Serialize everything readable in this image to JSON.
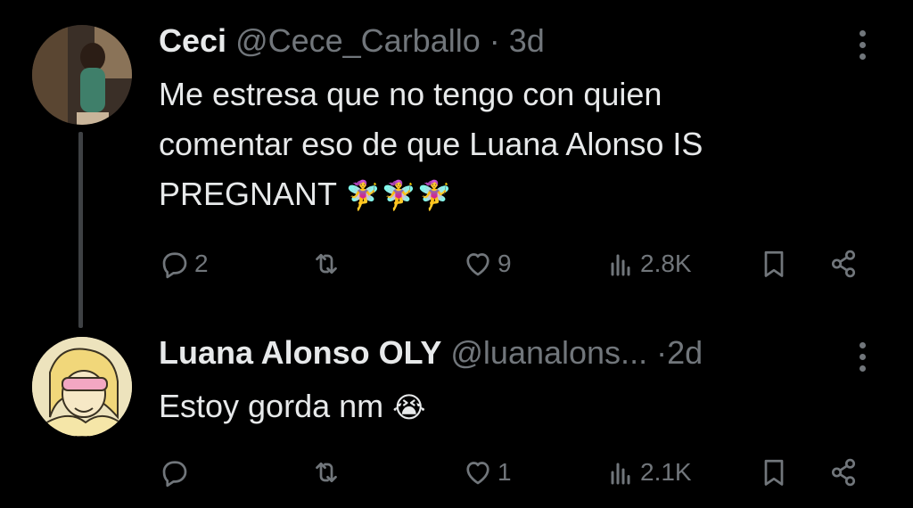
{
  "tweets": [
    {
      "name": "Ceci",
      "handle": "@Cece_Carballo",
      "dot": "·",
      "time": "3d",
      "text_lines": [
        "Me estresa que no tengo con quien",
        "comentar eso de que Luana Alonso IS",
        "PREGNANT"
      ],
      "emojis": "🧚‍♀️🧚‍♀️🧚‍♀️",
      "replies": "2",
      "retweets": "",
      "likes": "9",
      "views": "2.8K"
    },
    {
      "name": "Luana Alonso OLY",
      "handle": "@luanalons...",
      "dot": "·",
      "time": "2d",
      "text_lines": [
        "Estoy gorda nm"
      ],
      "emojis": "😭",
      "replies": "",
      "retweets": "",
      "likes": "1",
      "views": "2.1K"
    }
  ],
  "icons": {
    "reply": "reply-icon",
    "retweet": "retweet-icon",
    "like": "heart-icon",
    "views": "views-icon",
    "bookmark": "bookmark-icon",
    "share": "share-icon",
    "more": "more-vertical-icon"
  },
  "colors": {
    "background": "#000000",
    "text": "#e7e9ea",
    "secondary": "#71767b",
    "thread_line": "#3e4144"
  }
}
